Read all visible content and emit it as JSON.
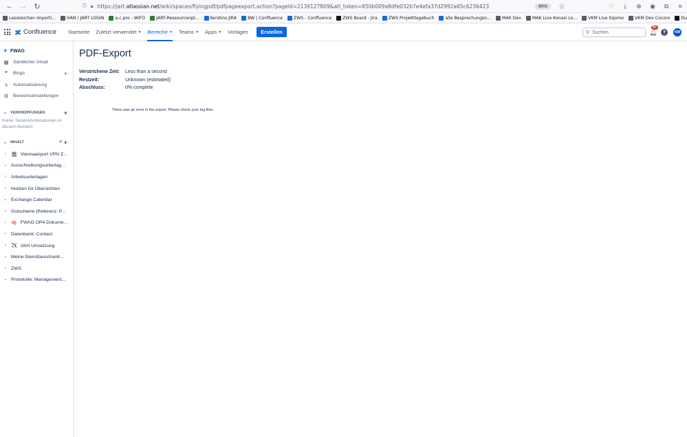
{
  "browser": {
    "url_prefix": "https://jart.",
    "url_host": "atlassian.net",
    "url_rest": "/wiki/spaces/flyingpdf/pdfpageexport.action?pageId=2139127809&atl_token=850b009a8dfe032b7e4efa37d2992a65c6236423",
    "zoom": "90%",
    "bookmarks": [
      {
        "label": "Lesezeichen importi...",
        "color": "#5b5b66"
      },
      {
        "label": "HAN / JART LOGIN",
        "color": "#5b5b66"
      },
      {
        "label": "a.c.pro - WIFO",
        "color": "#2e7d32"
      },
      {
        "label": "JART-Ressourcenpl...",
        "color": "#2e7d32"
      },
      {
        "label": "Kerstins JIRA",
        "color": "#1868db"
      },
      {
        "label": "BW | Confluence",
        "color": "#1868db"
      },
      {
        "label": "ZWS - Confluence",
        "color": "#1868db"
      },
      {
        "label": "ZWS Board - Jira",
        "color": "#15141a"
      },
      {
        "label": "ZWS Projekttagebuch",
        "color": "#1868db"
      },
      {
        "label": "alle Besprechungsn...",
        "color": "#1868db"
      },
      {
        "label": "MAK Dev",
        "color": "#5b5b66"
      },
      {
        "label": "MAK Live Konasi Lo...",
        "color": "#5b5b66"
      },
      {
        "label": "VKM Live tiqomo",
        "color": "#5b5b66"
      },
      {
        "label": "VKM Dev Cocoro",
        "color": "#5b5b66"
      },
      {
        "label": "Duden",
        "color": "#15141a"
      }
    ]
  },
  "header": {
    "logo": "Confluence",
    "nav": [
      {
        "label": "Startseite",
        "caret": false,
        "active": false
      },
      {
        "label": "Zuletzt verwendet",
        "caret": true,
        "active": false
      },
      {
        "label": "Bereiche",
        "caret": true,
        "active": true
      },
      {
        "label": "Teams",
        "caret": true,
        "active": false
      },
      {
        "label": "Apps",
        "caret": true,
        "active": false
      },
      {
        "label": "Vorlagen",
        "caret": false,
        "active": false
      }
    ],
    "create": "Erstellen",
    "search_placeholder": "Suchen",
    "notifications": "9+",
    "avatar": "KM"
  },
  "sidebar": {
    "space": "FWAG",
    "links": [
      {
        "label": "Sämtlicher Inhalt",
        "icon": "content-icon",
        "glyph": "▦",
        "plus": false
      },
      {
        "label": "Blogs",
        "icon": "quote-icon",
        "glyph": "❞",
        "plus": true
      },
      {
        "label": "Automatisierung",
        "icon": "lightning-icon",
        "glyph": "ϟ",
        "plus": false
      },
      {
        "label": "Bereichseinstellungen",
        "icon": "gear-icon",
        "glyph": "⚙",
        "plus": false
      }
    ],
    "shortcuts_heading": "VERKNÜPFUNGEN",
    "shortcuts_empty": "Keine Tastenkombinationen in diesem Bereich",
    "content_heading": "INHALT",
    "tree": [
      {
        "label": "Viennaairport VPN Z...",
        "emoji": "🏛",
        "expand": true
      },
      {
        "label": "Ausschreibungsunterlag...",
        "emoji": "",
        "expand": true
      },
      {
        "label": "Arbeitsunterlagen",
        "emoji": "",
        "expand": true
      },
      {
        "label": "Notizen für Übersichten",
        "emoji": "",
        "expand": false
      },
      {
        "label": "Exchange Calendar",
        "emoji": "",
        "expand": false
      },
      {
        "label": "Gutscheine (Referenz: P...",
        "emoji": "",
        "expand": false
      },
      {
        "label": "FWAG OP4 Dokume...",
        "emoji": "🧠",
        "expand": true
      },
      {
        "label": "Datenbank: Contact",
        "emoji": "",
        "expand": false
      },
      {
        "label": "VAH Umsetzung",
        "emoji": "✈️",
        "expand": false
      },
      {
        "label": "Meine Diensttauschantr...",
        "emoji": "",
        "expand": true
      },
      {
        "label": "ZWS",
        "emoji": "",
        "expand": true
      },
      {
        "label": "Protokolle: Management...",
        "emoji": "",
        "expand": false
      }
    ]
  },
  "main": {
    "title": "PDF-Export",
    "rows": [
      {
        "key": "Verstrichene Zeit:",
        "value": "Less than a second"
      },
      {
        "key": "Restzeit:",
        "value": "Unknown (estimated)"
      },
      {
        "key": "Abschluss:",
        "value": "0% complete"
      }
    ],
    "error": "There was an error in the export. Please check your log files."
  }
}
